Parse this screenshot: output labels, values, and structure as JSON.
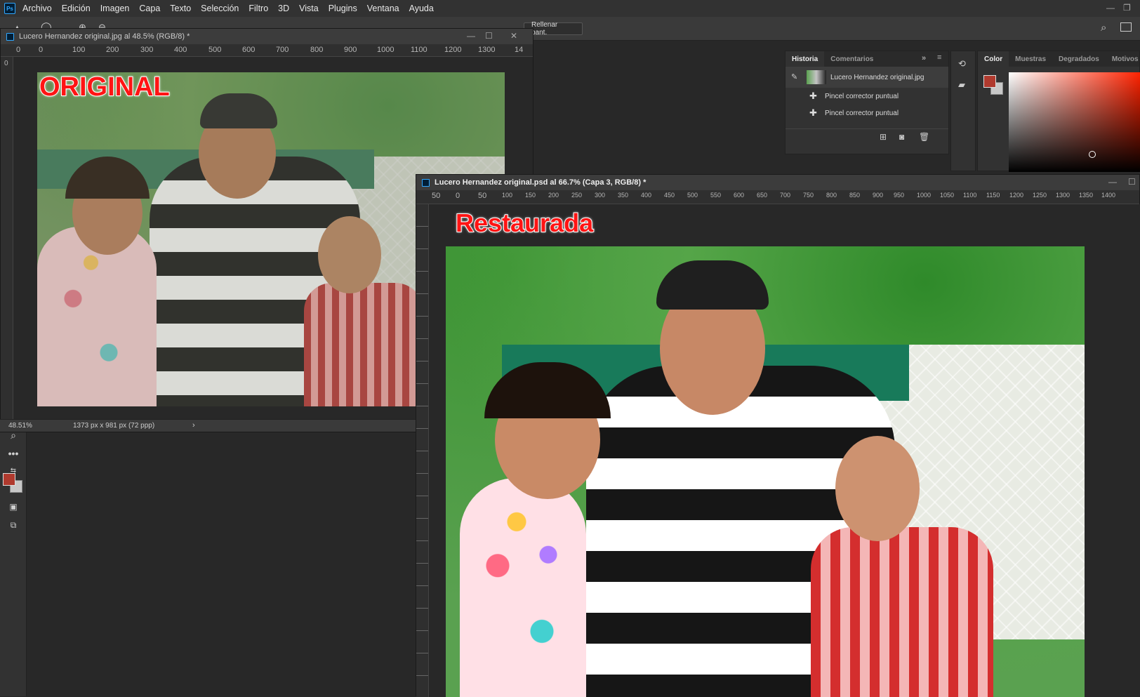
{
  "menubar": {
    "app_logo": "Ps",
    "items": [
      "Archivo",
      "Edición",
      "Imagen",
      "Capa",
      "Texto",
      "Selección",
      "Filtro",
      "3D",
      "Vista",
      "Plugins",
      "Ventana",
      "Ayuda"
    ]
  },
  "optionsbar": {
    "fill_screen_label": "Rellenar pant."
  },
  "doc_original": {
    "title": "Lucero Hernandez original.jpg al 48.5% (RGB/8) *",
    "ruler_h": [
      "0",
      "0",
      "100",
      "200",
      "300",
      "400",
      "500",
      "600",
      "700",
      "800",
      "900",
      "1000",
      "1100",
      "1200",
      "1300",
      "14"
    ],
    "ruler_v_top": "0",
    "overlay_label": "ORIGINAL"
  },
  "doc_restored": {
    "title": "Lucero Hernandez original.psd al 66.7% (Capa 3, RGB/8) *",
    "ruler_h": [
      "50",
      "0",
      "50",
      "100",
      "150",
      "200",
      "250",
      "300",
      "350",
      "400",
      "450",
      "500",
      "550",
      "600",
      "650",
      "700",
      "750",
      "800",
      "850",
      "900",
      "950",
      "1000",
      "1050",
      "1100",
      "1150",
      "1200",
      "1250",
      "1300",
      "1350",
      "1400"
    ],
    "overlay_label": "Restaurada"
  },
  "status": {
    "zoom": "48.51%",
    "doc_info": "1373 px x 981 px (72 ppp)"
  },
  "history_panel": {
    "tabs": [
      "Historia",
      "Comentarios"
    ],
    "active_tab": "Historia",
    "snapshot": "Lucero Hernandez original.jpg",
    "steps": [
      "Pincel corrector puntual",
      "Pincel corrector puntual"
    ]
  },
  "color_panel": {
    "tabs": [
      "Color",
      "Muestras",
      "Degradados",
      "Motivos"
    ],
    "active_tab": "Color",
    "foreground": "#b03a2e",
    "background": "#c8c8c8"
  }
}
